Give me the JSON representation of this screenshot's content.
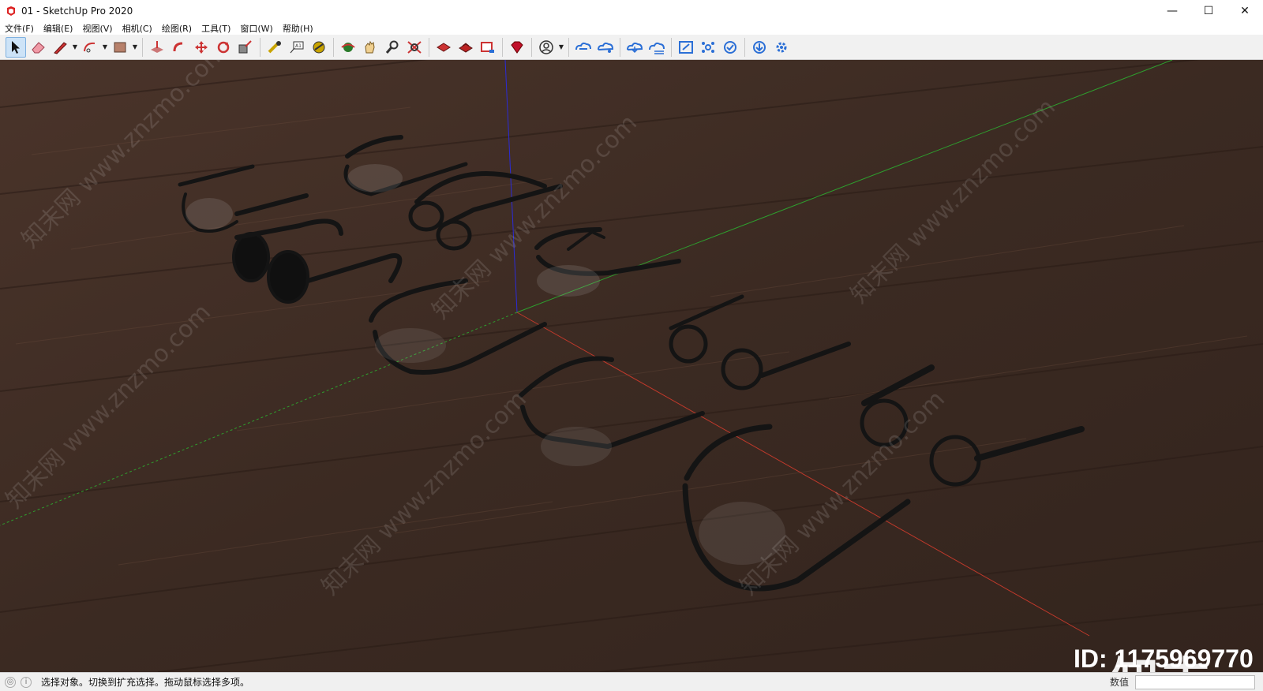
{
  "window": {
    "title": "01 - SketchUp Pro 2020",
    "controls": {
      "minimize": "—",
      "maximize": "☐",
      "close": "✕"
    }
  },
  "menu": [
    {
      "label": "文件(F)"
    },
    {
      "label": "编辑(E)"
    },
    {
      "label": "视图(V)"
    },
    {
      "label": "相机(C)"
    },
    {
      "label": "绘图(R)"
    },
    {
      "label": "工具(T)"
    },
    {
      "label": "窗口(W)"
    },
    {
      "label": "帮助(H)"
    }
  ],
  "toolbar": [
    "select-tool-icon",
    "eraser-tool-icon",
    "pencil-line-tool-icon",
    "arc-tool-icon",
    "paint-bucket-icon",
    "push-pull-icon",
    "follow-me-icon",
    "move-icon",
    "rotate-icon",
    "scale-icon",
    "tape-measure-icon",
    "text-icon",
    "dimension-icon",
    "orbit-icon",
    "pan-icon",
    "zoom-icon",
    "zoom-extents-icon",
    "warehouse-icon",
    "extension-warehouse-icon",
    "layout-icon",
    "ruby-icon",
    "account-icon",
    "cloud-link-icon",
    "cloud-share-icon",
    "cloud-download-icon",
    "cloud-list-icon",
    "resize-icon",
    "components-icon",
    "refresh-check-icon",
    "download-icon",
    "settings-icon"
  ],
  "viewport": {
    "floor_color": "#3f2b22",
    "axis_colors": {
      "x": "#c0392b",
      "y": "#2e9e2e",
      "z": "#2b2bd6"
    },
    "watermark_text": "知末网 www.znzmo.com",
    "logo_text": "知末",
    "id_text": "ID: 1175969770"
  },
  "status": {
    "message": "选择对象。切换到扩充选择。拖动鼠标选择多项。",
    "measure_label": "数值"
  }
}
